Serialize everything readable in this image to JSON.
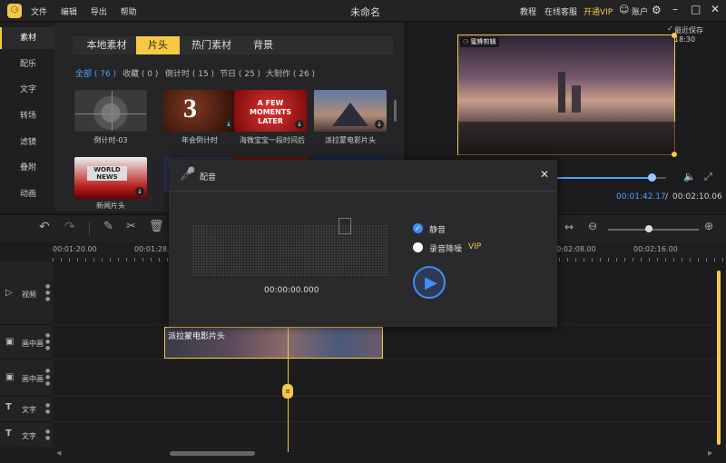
{
  "titlebar": {
    "logo_icon": "bee-logo-icon",
    "menu": [
      "文件",
      "编辑",
      "导出",
      "帮助"
    ],
    "title": "未命名",
    "links": [
      "教程",
      "在线客服",
      "开通VIP"
    ],
    "account": "账户",
    "vip_color": "#f7c844"
  },
  "leftnav": {
    "items": [
      "素材",
      "配乐",
      "文字",
      "转场",
      "滤镜",
      "叠附",
      "动画"
    ]
  },
  "media": {
    "tabs": [
      "本地素材",
      "片头",
      "热门素材",
      "背景"
    ],
    "filters": [
      "全部 ( 76 )",
      "收藏 ( 0 )",
      "倒计时 ( 15 )",
      "节日 ( 25 )",
      "大制作 ( 26 )"
    ],
    "items": [
      {
        "label": "倒计时-03"
      },
      {
        "label": "年会倒计时",
        "overlay": "3"
      },
      {
        "label": "海微宝宝一段时间后",
        "overlay": "A FEW MOMENTS LATER"
      },
      {
        "label": "派拉蒙电影片头"
      },
      {
        "label": "新闻片头",
        "overlay": "WORLD NEWS"
      }
    ]
  },
  "preview": {
    "autosave": "最近保存 18:30",
    "watermark": "蜜蜂剪辑",
    "time_current": "00:01:42.17",
    "time_sep": "/",
    "time_total": "00:02:10.06",
    "progress": 0.87
  },
  "timeline": {
    "ruler_ticks": [
      "00:01:20.00",
      "00:01:28.00",
      "00:02:08.00",
      "00:02:16.00"
    ],
    "tracks": [
      "视频",
      "画中画",
      "画中画",
      "文字",
      "文字"
    ],
    "clip_label": "派拉蒙电影片头",
    "zoom": 0.45
  },
  "dialog": {
    "title": "配音",
    "mute_label": "静音",
    "mute_checked": true,
    "denoise_label": "录音降噪",
    "vip_badge": "VIP",
    "timecode": "00:00:00.000"
  }
}
